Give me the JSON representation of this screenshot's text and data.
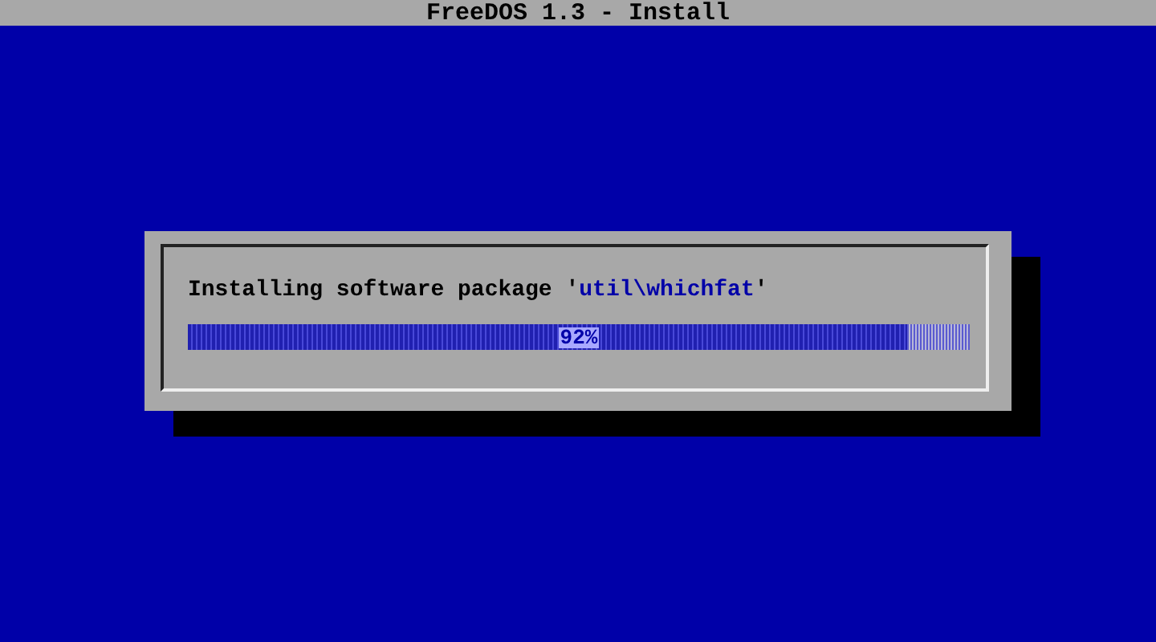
{
  "window": {
    "title": "FreeDOS 1.3 - Install"
  },
  "dialog": {
    "message": "Installing software package '",
    "package": "util\\whichfat",
    "message_end": "'",
    "progress": {
      "level": 0.92,
      "reading": "92%"
    }
  }
}
